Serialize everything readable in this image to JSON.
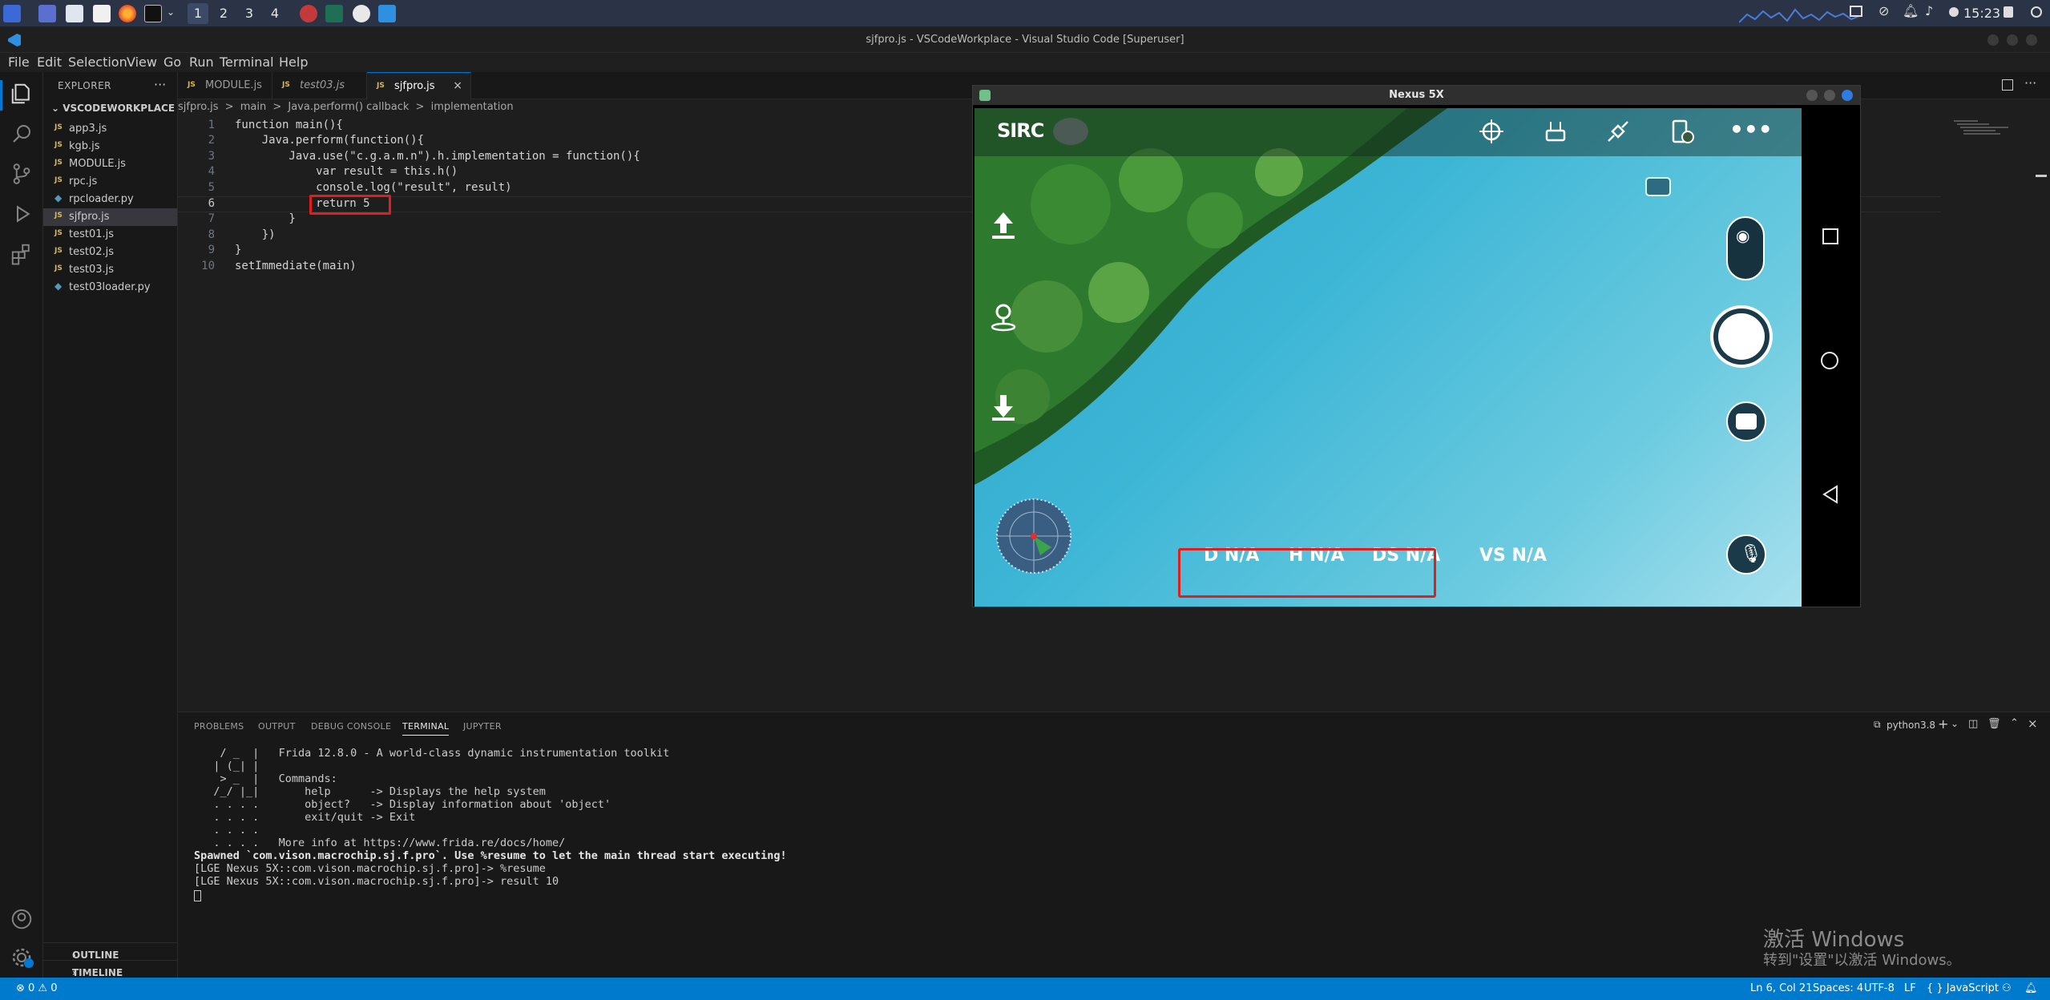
{
  "system_panel": {
    "workspaces": [
      "1",
      "2",
      "3",
      "4"
    ],
    "clock": "15:23"
  },
  "vscode": {
    "window_title": "sjfpro.js - VSCodeWorkplace - Visual Studio Code [Superuser]",
    "menu": [
      "File",
      "Edit",
      "Selection",
      "View",
      "Go",
      "Run",
      "Terminal",
      "Help"
    ],
    "explorer": {
      "header": "EXPLORER",
      "folder": "VSCODEWORKPLACE",
      "files": [
        {
          "name": "app3.js",
          "type": "JS"
        },
        {
          "name": "kgb.js",
          "type": "JS"
        },
        {
          "name": "MODULE.js",
          "type": "JS"
        },
        {
          "name": "rpc.js",
          "type": "JS"
        },
        {
          "name": "rpcloader.py",
          "type": "py"
        },
        {
          "name": "sjfpro.js",
          "type": "JS"
        },
        {
          "name": "test01.js",
          "type": "JS"
        },
        {
          "name": "test02.js",
          "type": "JS"
        },
        {
          "name": "test03.js",
          "type": "JS"
        },
        {
          "name": "test03loader.py",
          "type": "py"
        }
      ],
      "outline": "OUTLINE",
      "timeline": "TIMELINE"
    },
    "tabs": [
      {
        "label": "MODULE.js",
        "icon": "JS"
      },
      {
        "label": "test03.js",
        "icon": "JS"
      },
      {
        "label": "sjfpro.js",
        "icon": "JS",
        "close": "×"
      }
    ],
    "breadcrumb": [
      "sjfpro.js",
      ">",
      "main",
      ">",
      "Java.perform() callback",
      ">",
      "implementation"
    ],
    "code_lines": [
      {
        "n": "1",
        "text": "function main(){"
      },
      {
        "n": "2",
        "text": "    Java.perform(function(){"
      },
      {
        "n": "3",
        "text": "        Java.use(\"c.g.a.m.n\").h.implementation = function(){"
      },
      {
        "n": "4",
        "text": "            var result = this.h()"
      },
      {
        "n": "5",
        "text": "            console.log(\"result\", result)"
      },
      {
        "n": "6",
        "text": "            return 5"
      },
      {
        "n": "7",
        "text": "        }"
      },
      {
        "n": "8",
        "text": "    })"
      },
      {
        "n": "9",
        "text": "}"
      },
      {
        "n": "10",
        "text": "setImmediate(main)"
      }
    ],
    "panel": {
      "tabs": [
        "PROBLEMS",
        "OUTPUT",
        "DEBUG CONSOLE",
        "TERMINAL",
        "JUPYTER"
      ],
      "terminal_name": "python3.8",
      "terminal_lines": [
        "    / _  |   Frida 12.8.0 - A world-class dynamic instrumentation toolkit",
        "   | (_| |",
        "    > _  |   Commands:",
        "   /_/ |_|       help      -> Displays the help system",
        "   . . . .       object?   -> Display information about 'object'",
        "   . . . .       exit/quit -> Exit",
        "   . . . .",
        "   . . . .   More info at https://www.frida.re/docs/home/",
        "Spawned `com.vison.macrochip.sj.f.pro`. Use %resume to let the main thread start executing!",
        "[LGE Nexus 5X::com.vison.macrochip.sj.f.pro]-> %resume",
        "[LGE Nexus 5X::com.vison.macrochip.sj.f.pro]-> result 10"
      ]
    },
    "activation_watermark": {
      "line1": "激活 Windows",
      "line2": "转到\"设置\"以激活 Windows。"
    },
    "statusbar": {
      "problems": "⊗ 0 ⚠ 0",
      "position": "Ln 6, Col 21",
      "spaces": "Spaces: 4",
      "encoding": "UTF-8",
      "eol": "LF",
      "language": "{ } JavaScript"
    }
  },
  "emulator": {
    "title": "Nexus 5X",
    "app_logo": "SIRC",
    "hud": {
      "distance": "D N/A",
      "height": "H N/A",
      "ds": "DS N/A",
      "vs": "VS N/A"
    },
    "colors": {
      "highlight_box": "#e01e1e",
      "water": "#3db6d6"
    }
  }
}
